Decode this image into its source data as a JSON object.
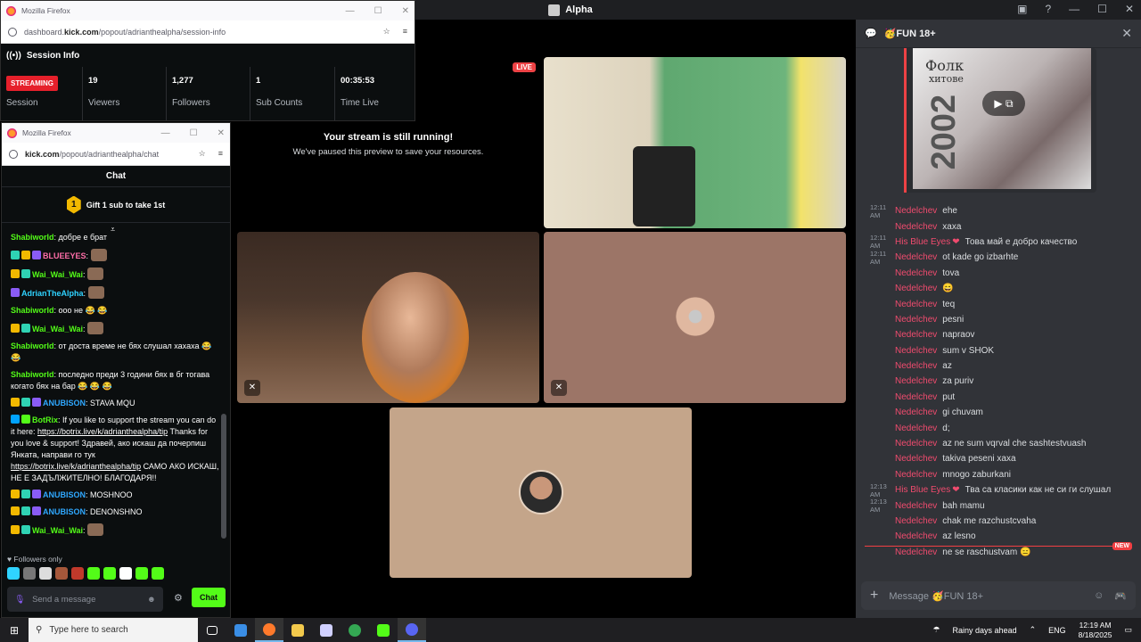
{
  "discord": {
    "window_title": "Alpha",
    "stream_tile": {
      "live_badge": "LIVE",
      "message_title": "Your stream is still running!",
      "message_sub": "We've paused this preview to save your resources."
    },
    "chat": {
      "channel": "🥳FUN 18+",
      "album": {
        "line1": "Фолк",
        "line2": "хитове",
        "year": "2002"
      },
      "messages": [
        {
          "time": "12:11 AM",
          "author": "Nedelchev",
          "text": "ehe"
        },
        {
          "time": "",
          "author": "Nedelchev",
          "text": "xaxa"
        },
        {
          "time": "12:11 AM",
          "author": "His Blue Eyes",
          "text": "Това май е добро качество"
        },
        {
          "time": "12:11 AM",
          "author": "Nedelchev",
          "text": "ot kade go izbarhte"
        },
        {
          "time": "",
          "author": "Nedelchev",
          "text": "tova"
        },
        {
          "time": "",
          "author": "Nedelchev",
          "text": "😄"
        },
        {
          "time": "",
          "author": "Nedelchev",
          "text": "teq"
        },
        {
          "time": "",
          "author": "Nedelchev",
          "text": "pesni"
        },
        {
          "time": "",
          "author": "Nedelchev",
          "text": "napraov"
        },
        {
          "time": "",
          "author": "Nedelchev",
          "text": "sum v SHOK"
        },
        {
          "time": "",
          "author": "Nedelchev",
          "text": "az"
        },
        {
          "time": "",
          "author": "Nedelchev",
          "text": "za puriv"
        },
        {
          "time": "",
          "author": "Nedelchev",
          "text": "put"
        },
        {
          "time": "",
          "author": "Nedelchev",
          "text": "gi chuvam"
        },
        {
          "time": "",
          "author": "Nedelchev",
          "text": "d;"
        },
        {
          "time": "",
          "author": "Nedelchev",
          "text": "az ne sum vqrval che sashtestvuash"
        },
        {
          "time": "",
          "author": "Nedelchev",
          "text": "takiva peseni xaxa"
        },
        {
          "time": "",
          "author": "Nedelchev",
          "text": "mnogo zaburkani"
        },
        {
          "time": "12:13 AM",
          "author": "His Blue Eyes",
          "text": "Тва са класики как не си ги слушал"
        },
        {
          "time": "12:13 AM",
          "author": "Nedelchev",
          "text": "bah mamu"
        },
        {
          "time": "",
          "author": "Nedelchev",
          "text": "chak me razchustcvaha"
        },
        {
          "time": "",
          "author": "Nedelchev",
          "text": "az lesno"
        },
        {
          "time": "",
          "author": "Nedelchev",
          "text": "ne se raschustvam 😑"
        }
      ],
      "new_badge": "NEW",
      "input_placeholder": "Message 🥳FUN 18+"
    }
  },
  "session_popup": {
    "browser": "Mozilla Firefox",
    "url_prefix": "dashboard.",
    "url_domain": "kick.com",
    "url_path": "/popout/adrianthealpha/session-info",
    "title": "Session Info",
    "streaming_badge": "STREAMING",
    "session_label": "Session",
    "stats": [
      {
        "value": "19",
        "label": "Viewers"
      },
      {
        "value": "1,277",
        "label": "Followers"
      },
      {
        "value": "1",
        "label": "Sub Counts"
      },
      {
        "value": "00:35:53",
        "label": "Time Live"
      }
    ]
  },
  "chat_popup": {
    "browser": "Mozilla Firefox",
    "url_domain": "kick.com",
    "url_path": "/popout/adrianthealpha/chat",
    "header": "Chat",
    "gift_text": "Gift 1 sub to take 1st",
    "gift_count": "1",
    "messages": [
      {
        "user": "Shabiworld",
        "color": "#53fc18",
        "text": "добре е брат"
      },
      {
        "user": "BLUEEYES",
        "color": "#ff6ea8",
        "text": ""
      },
      {
        "user": "Wai_Wai_Wai",
        "color": "#53fc18",
        "text": ""
      },
      {
        "user": "AdrianTheAlpha",
        "color": "#2fd3ff",
        "text": ""
      },
      {
        "user": "Shabiworld",
        "color": "#53fc18",
        "text": "ооо не 😂 😂"
      },
      {
        "user": "Wai_Wai_Wai",
        "color": "#53fc18",
        "text": ""
      },
      {
        "user": "Shabiworld",
        "color": "#53fc18",
        "text": "от доста време не бях слушал хахаха 😂 😂"
      },
      {
        "user": "Shabiworld",
        "color": "#53fc18",
        "text": "последно преди 3 години бях в бг тогава когато бях на бар 😂 😂 😂"
      },
      {
        "user": "ANUBISON",
        "color": "#2fa8ff",
        "text": "STAVA MQU"
      },
      {
        "user": "BotRix",
        "color": "#53fc18",
        "text": "If you like to support the stream you can do it here: ",
        "link": "https://botrix.live/k/adrianthealpha/tip",
        "text2": " Thanks for you love & support! Здравей, ако искаш да почерпиш Янката, направи го тук ",
        "link2": "https://botrix.live/k/adrianthealpha/tip",
        "text3": " САМО АКО ИСКАШ, НЕ Е ЗАДЪЛЖИТЕЛНО! БЛАГОДАРЯ!!"
      },
      {
        "user": "ANUBISON",
        "color": "#2fa8ff",
        "text": "MOSHNOO"
      },
      {
        "user": "ANUBISON",
        "color": "#2fa8ff",
        "text": "DENONSHNO"
      },
      {
        "user": "Wai_Wai_Wai",
        "color": "#53fc18",
        "text": ""
      }
    ],
    "followers_only": "Followers only",
    "input_placeholder": "Send a message",
    "send_label": "Chat"
  },
  "taskbar": {
    "search_placeholder": "Type here to search",
    "weather": "Rainy days ahead",
    "lang": "ENG",
    "time": "12:19 AM",
    "date": "8/18/2025"
  }
}
